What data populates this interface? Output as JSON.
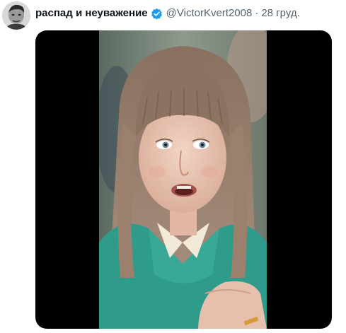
{
  "tweet": {
    "author_name": "распад и неуважение",
    "handle": "@VictorKvert2008",
    "separator": "·",
    "date": "28 груд."
  },
  "icons": {
    "verified": "verified-badge-icon",
    "accent_color": "#1d9bf0"
  },
  "colors": {
    "name": "#0f1419",
    "secondary": "#536471",
    "media_background": "#000000"
  }
}
